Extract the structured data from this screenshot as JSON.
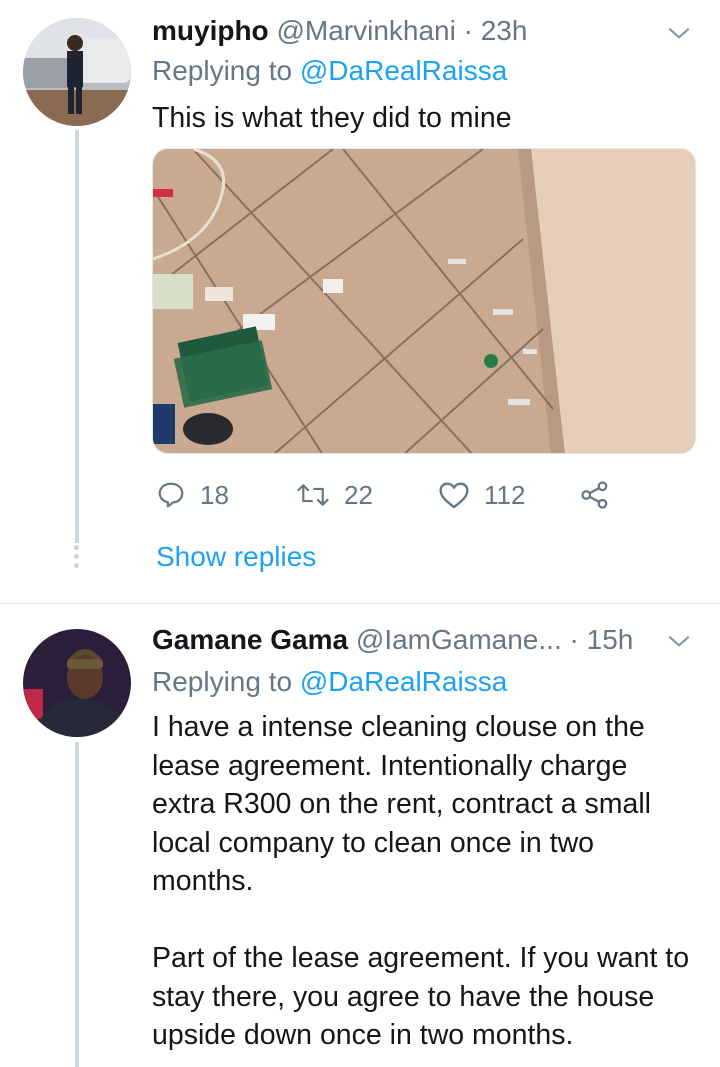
{
  "tweets": [
    {
      "name": "muyipho",
      "handle": "@Marvinkhani",
      "time": "· 23h",
      "replying_prefix": "Replying to ",
      "replying_to": "@DaRealRaissa",
      "text": "This is what they did to mine",
      "actions": {
        "replies": "18",
        "retweets": "22",
        "likes": "112"
      },
      "show_replies": "Show replies"
    },
    {
      "name": "Gamane Gama",
      "handle": "@IamGamane...",
      "time": "· 15h",
      "replying_prefix": "Replying to ",
      "replying_to": "@DaRealRaissa",
      "text": "I have a intense cleaning clouse on the lease agreement. Intentionally charge extra R300 on the rent, contract a small local company to clean once in two months.\n\nPart of the lease agreement. If you want to stay there, you agree to have the house upside down once in two months."
    }
  ],
  "colors": {
    "accent": "#1da1f2",
    "secondary": "#657786",
    "border": "#e1e8ed",
    "thread": "#ccd6dd"
  },
  "icons": [
    "reply-icon",
    "retweet-icon",
    "like-icon",
    "share-icon",
    "chevron-down-icon"
  ]
}
